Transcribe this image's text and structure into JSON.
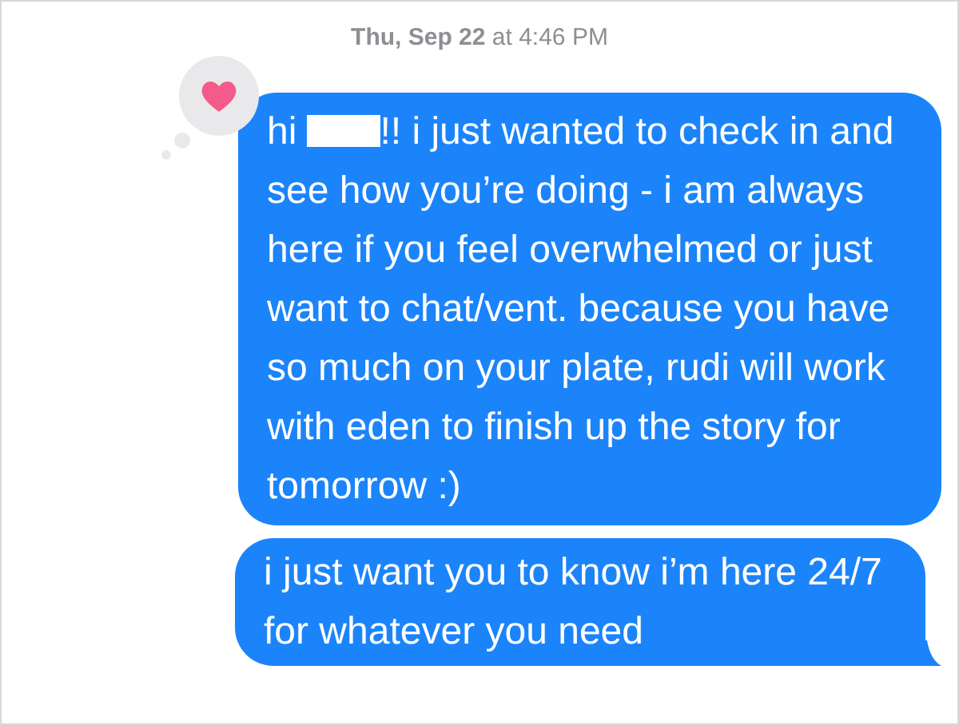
{
  "timestamp": "**Thu, Sep 22** at 4:46 PM",
  "tapback": {
    "kind": "heart"
  },
  "messages": [
    {
      "text_before": "hi",
      "redacted": true,
      "text_after": "!! i just wanted to check in and see how you’re doing - i am always here if you feel overwhelmed or just want to chat/vent. because you have so much on your plate, rudi will work with eden to finish up the story for tomorrow :)",
      "tail": false
    },
    {
      "text_before": "i just want you to know i’m here 24/7 for whatever you need",
      "redacted": false,
      "tail": true
    }
  ]
}
